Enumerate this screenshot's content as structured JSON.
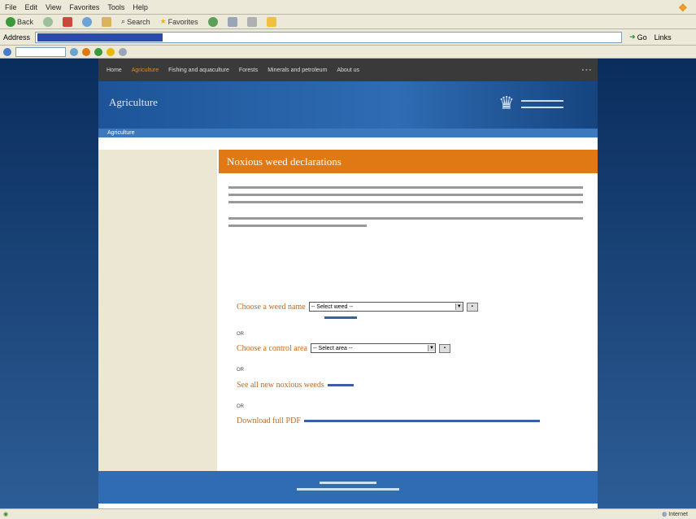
{
  "browser": {
    "menu": [
      "File",
      "Edit",
      "View",
      "Favorites",
      "Tools",
      "Help"
    ],
    "toolbar": {
      "back": "Back",
      "search": "Search",
      "favorites": "Favorites"
    },
    "address_label": "Address",
    "go": "Go",
    "links": "Links",
    "status_zone": "Internet",
    "colors": {
      "chrome": "#ece9d8",
      "address_select": "#2c4aa8"
    }
  },
  "site": {
    "nav": [
      "Home",
      "Agriculture",
      "Fishing and aquaculture",
      "Forests",
      "Minerals and petroleum",
      "About us"
    ],
    "nav_active": "Agriculture",
    "banner_title": "Agriculture",
    "breadcrumb": "Agriculture",
    "colors": {
      "accent": "#e07814",
      "banner": "#2f6cb3",
      "nav": "#3a3a3a",
      "left_col": "#ece7d2"
    }
  },
  "content": {
    "heading": "Noxious weed declarations",
    "choose_weed_label": "Choose a weed name",
    "choose_weed_value": "-- Select weed --",
    "or1": "OR",
    "choose_area_label": "Choose a control area",
    "choose_area_value": "-- Select area --",
    "or2": "OR",
    "see_all_label": "See all new noxious weeds",
    "or3": "OR",
    "download_label": "Download full PDF"
  }
}
